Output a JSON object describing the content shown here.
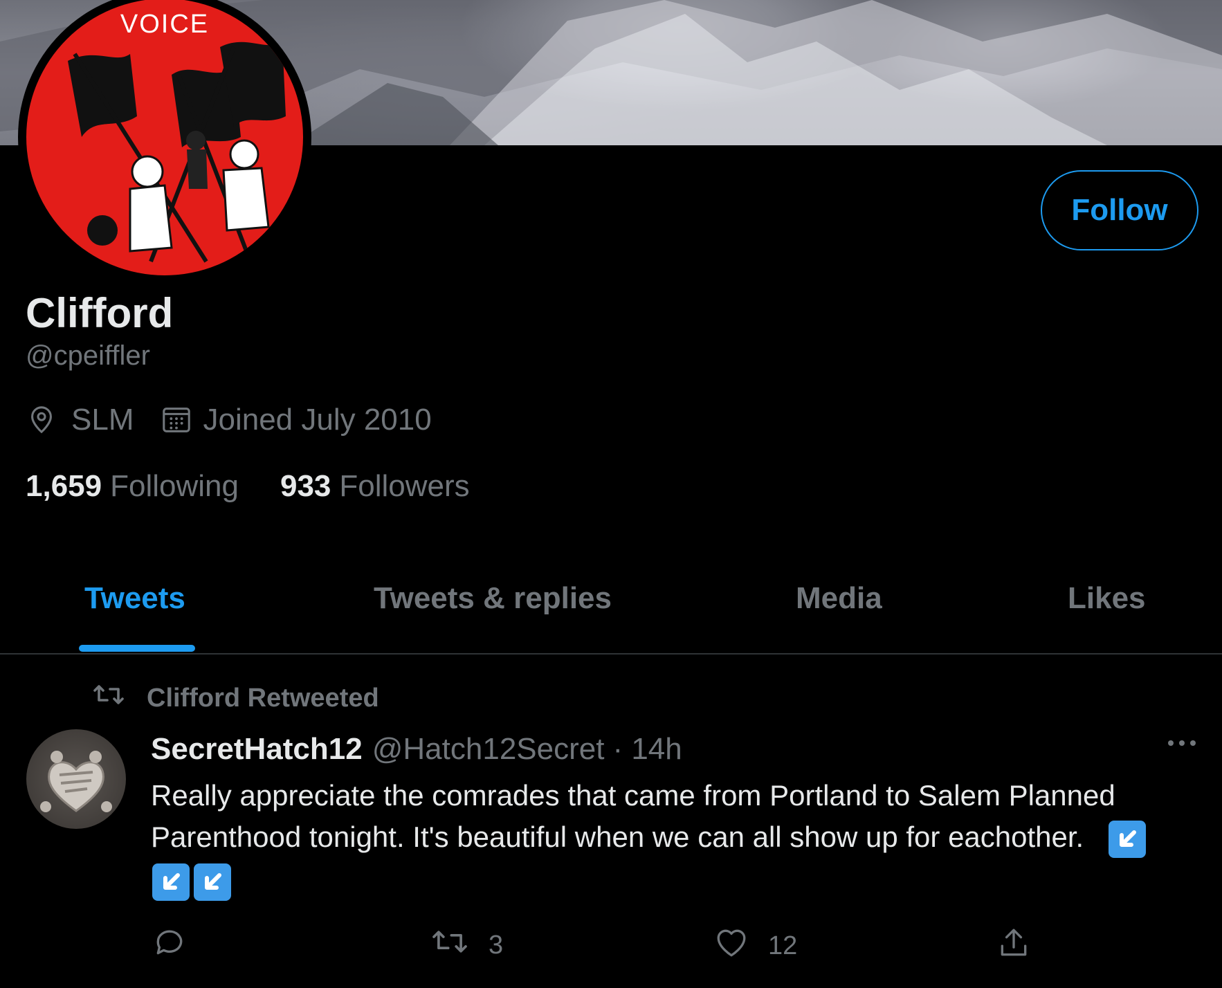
{
  "profile": {
    "avatar_word": "VOICE",
    "name": "Clifford",
    "handle": "@cpeiffler",
    "location": "SLM",
    "joined": "Joined July 2010",
    "following_count": "1,659",
    "following_label": "Following",
    "followers_count": "933",
    "followers_label": "Followers",
    "follow_label": "Follow"
  },
  "tabs": [
    {
      "label": "Tweets",
      "active": true
    },
    {
      "label": "Tweets & replies",
      "active": false
    },
    {
      "label": "Media",
      "active": false
    },
    {
      "label": "Likes",
      "active": false
    }
  ],
  "tweet": {
    "retweeted_by": "Clifford Retweeted",
    "author": "SecretHatch12",
    "author_handle": "@Hatch12Secret",
    "time": "· 14h",
    "text": "Really appreciate the comrades that came from Portland to Salem Planned Parenthood tonight. It's beautiful when we can all show up for eachother.",
    "emoji_icon": "arrow-down-left-emoji",
    "retweet_count": "3",
    "like_count": "12"
  },
  "colors": {
    "accent": "#1d9bf0",
    "background": "#000000",
    "secondary_text": "#71767b",
    "avatar_red": "#e31d19"
  },
  "icons": [
    "location-pin-icon",
    "calendar-icon",
    "retweet-icon",
    "more-icon",
    "reply-icon",
    "like-icon",
    "share-icon"
  ]
}
